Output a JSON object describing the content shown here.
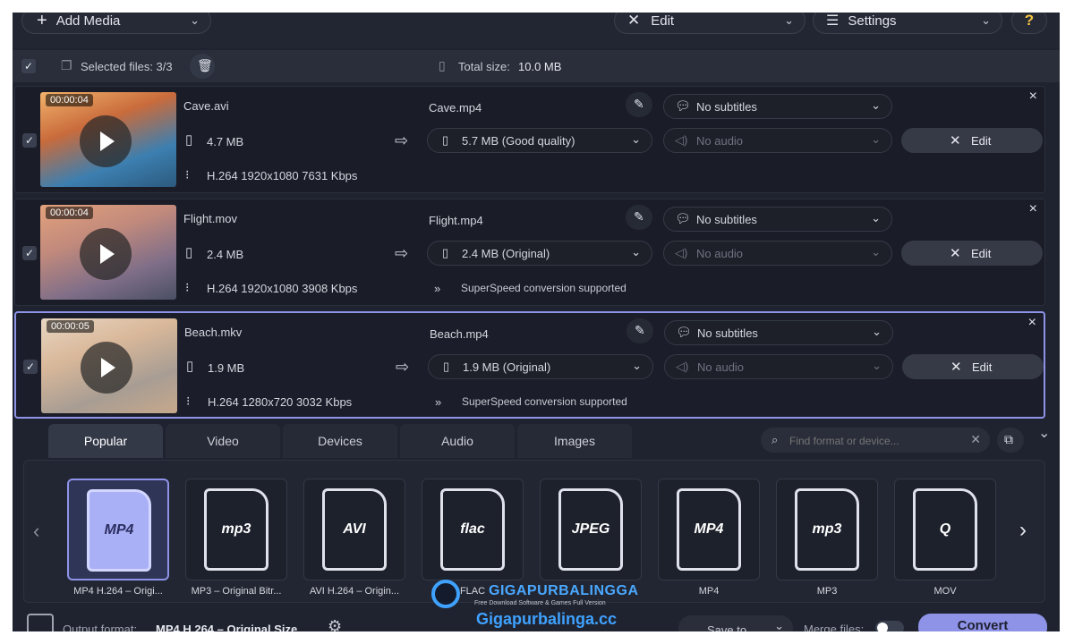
{
  "toolbar": {
    "add_media": "Add Media",
    "edit": "Edit",
    "settings": "Settings",
    "help": "?"
  },
  "selection": {
    "selected_label": "Selected files: 3/3",
    "total_label": "Total size:",
    "total_value": "10.0 MB"
  },
  "files": [
    {
      "duration": "00:00:04",
      "name": "Cave.avi",
      "size": "4.7 MB",
      "codec": "H.264 1920x1080 7631 Kbps",
      "output_name": "Cave.mp4",
      "output_size": "5.7 MB (Good quality)",
      "subtitles": "No subtitles",
      "audio": "No audio",
      "note": "",
      "edit": "Edit",
      "colors": [
        "#f2b36b",
        "#c96b3c",
        "#3c7fb0",
        "#2c5a7e"
      ]
    },
    {
      "duration": "00:00:04",
      "name": "Flight.mov",
      "size": "2.4 MB",
      "codec": "H.264 1920x1080 3908 Kbps",
      "output_name": "Flight.mp4",
      "output_size": "2.4 MB (Original)",
      "subtitles": "No subtitles",
      "audio": "No audio",
      "note": "SuperSpeed conversion supported",
      "edit": "Edit",
      "colors": [
        "#e3a27c",
        "#c28a7c",
        "#7f6e88",
        "#4a4f65"
      ]
    },
    {
      "duration": "00:00:05",
      "name": "Beach.mkv",
      "size": "1.9 MB",
      "codec": "H.264 1280x720 3032 Kbps",
      "output_name": "Beach.mp4",
      "output_size": "1.9 MB (Original)",
      "subtitles": "No subtitles",
      "audio": "No audio",
      "note": "SuperSpeed conversion supported",
      "edit": "Edit",
      "colors": [
        "#e8d6c2",
        "#d9b89a",
        "#a89d93",
        "#c6a88c"
      ]
    }
  ],
  "format_tabs": [
    "Popular",
    "Video",
    "Devices",
    "Audio",
    "Images"
  ],
  "search": {
    "placeholder": "Find format or device..."
  },
  "formats": [
    {
      "logo": "MP4",
      "label": "MP4 H.264 – Origi..."
    },
    {
      "logo": "mp3",
      "label": "MP3 – Original Bitr..."
    },
    {
      "logo": "AVI",
      "label": "AVI H.264 – Origin..."
    },
    {
      "logo": "flac",
      "label": "FLAC"
    },
    {
      "logo": "JPEG",
      "label": ""
    },
    {
      "logo": "MP4",
      "label": "MP4"
    },
    {
      "logo": "mp3",
      "label": "MP3"
    },
    {
      "logo": "Q",
      "label": "MOV"
    }
  ],
  "bottom": {
    "output_label": "Output format:",
    "output_value": "MP4 H.264 – Original Size",
    "save_to": "Save to",
    "merge": "Merge files:",
    "convert": "Convert"
  },
  "watermark": {
    "brand": "GIGAPURBALINGGA",
    "tagline": "Free Download Software & Games Full Version",
    "url": "Gigapurbalinga.cc"
  }
}
